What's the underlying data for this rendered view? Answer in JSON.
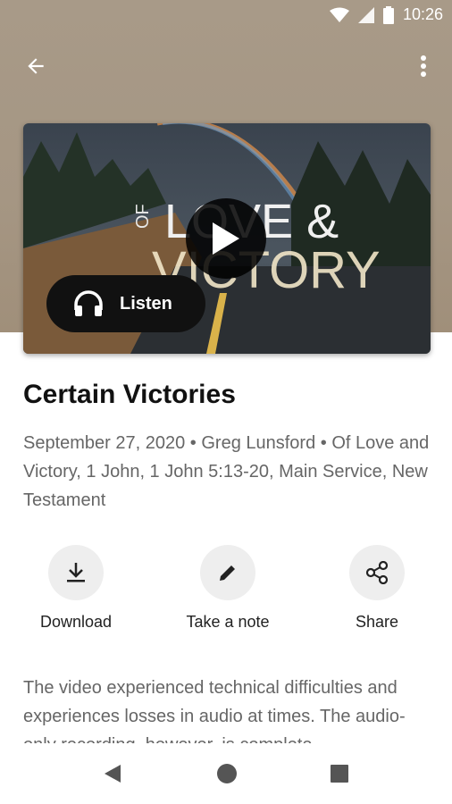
{
  "status_bar": {
    "time": "10:26",
    "icons": [
      "wifi-icon",
      "signal-icon",
      "battery-icon"
    ]
  },
  "toolbar": {
    "back_icon": "arrow-left-icon",
    "more_icon": "more-vertical-icon"
  },
  "media": {
    "artwork_title_lines": [
      "OF",
      "LOVE &",
      "VICTORY"
    ],
    "play_icon": "play-icon",
    "listen_label": "Listen",
    "listen_icon": "headphones-icon"
  },
  "sermon": {
    "title": "Certain Victories",
    "meta": "September 27, 2020 • Greg Lunsford • Of Love and Victory, 1 John, 1 John 5:13-20, Main Service, New Testament"
  },
  "actions": [
    {
      "label": "Download",
      "icon": "download-icon"
    },
    {
      "label": "Take a note",
      "icon": "pencil-icon"
    },
    {
      "label": "Share",
      "icon": "share-icon"
    }
  ],
  "description": "The video experienced technical difficulties and experiences losses in audio at times. The audio-only recording, however, is complete.",
  "nav": {
    "icons": [
      "back-triangle-icon",
      "home-circle-icon",
      "recents-square-icon"
    ]
  },
  "colors": {
    "hero_bg": "#a89a88",
    "button_dark": "#111111",
    "action_circle": "#eeeeee",
    "meta_text": "#666666"
  }
}
